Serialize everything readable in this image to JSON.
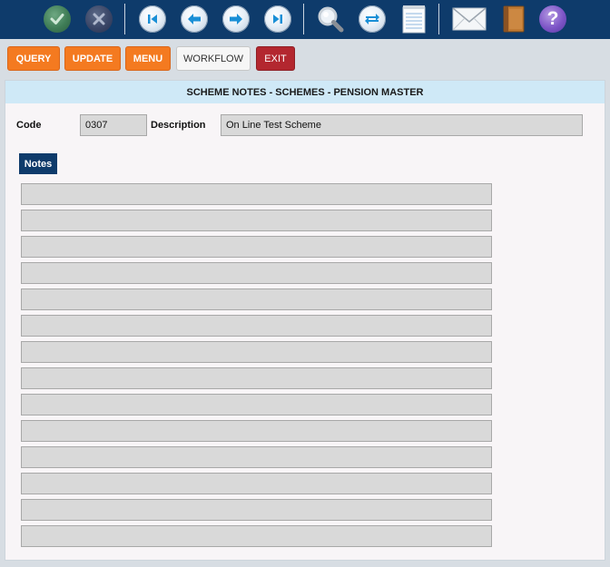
{
  "toolbar": {
    "icons": [
      "check-icon",
      "cancel-icon",
      "first-record-icon",
      "previous-icon",
      "next-icon",
      "last-record-icon",
      "search-icon",
      "refresh-icon",
      "notepad-icon",
      "mail-icon",
      "book-icon",
      "help-icon"
    ],
    "help_glyph": "?"
  },
  "actions": {
    "query_label": "QUERY",
    "update_label": "UPDATE",
    "menu_label": "MENU",
    "workflow_label": "WORKFLOW",
    "exit_label": "EXIT"
  },
  "panel": {
    "title": "SCHEME NOTES - SCHEMES - PENSION MASTER",
    "code_label": "Code",
    "code_value": "0307",
    "description_label": "Description",
    "description_value": "On Line Test Scheme",
    "notes_tab_label": "Notes",
    "notes": [
      "",
      "",
      "",
      "",
      "",
      "",
      "",
      "",
      "",
      "",
      "",
      "",
      "",
      ""
    ]
  },
  "colors": {
    "toolbar_bg": "#0e3b6b",
    "accent_orange": "#f47a20",
    "exit_red": "#b3272f",
    "header_blue": "#cfe9f7"
  }
}
